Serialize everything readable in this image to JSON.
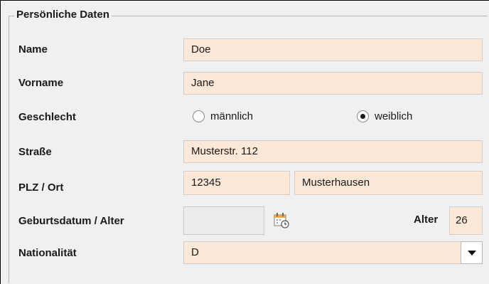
{
  "section": {
    "legend": "Persönliche Daten"
  },
  "fields": {
    "name": {
      "label": "Name",
      "value": "Doe"
    },
    "vorname": {
      "label": "Vorname",
      "value": "Jane"
    },
    "geschlecht": {
      "label": "Geschlecht",
      "options": [
        {
          "label": "männlich",
          "selected": false
        },
        {
          "label": "weiblich",
          "selected": true
        }
      ]
    },
    "strasse": {
      "label": "Straße",
      "value": "Musterstr. 112"
    },
    "plz_ort": {
      "label": "PLZ / Ort",
      "plz": "12345",
      "ort": "Musterhausen"
    },
    "geburtsdatum": {
      "label": "Geburtsdatum / Alter",
      "value": "",
      "alter_label": "Alter",
      "alter_value": "26"
    },
    "nationalitaet": {
      "label": "Nationalität",
      "value": "D"
    }
  },
  "colors": {
    "field_bg": "#fde7d6",
    "disabled_bg": "#ececec",
    "background": "#f0f0f0"
  },
  "icons": {
    "calendar": "calendar-icon",
    "dropdown": "chevron-down-icon"
  }
}
